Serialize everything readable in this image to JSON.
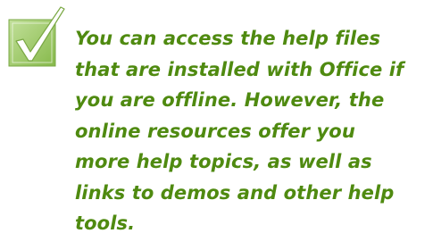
{
  "tip": {
    "icon": "checkmark-icon",
    "lines": [
      "You can access the help files",
      "that are installed with Office if",
      "you are offline. However, the",
      "online resources offer you",
      "more help topics, as well as",
      "links to demos and other help",
      "tools."
    ]
  },
  "colors": {
    "text": "#4f8a10",
    "box_fill": "#9ccc5c",
    "check": "#ffffff"
  }
}
